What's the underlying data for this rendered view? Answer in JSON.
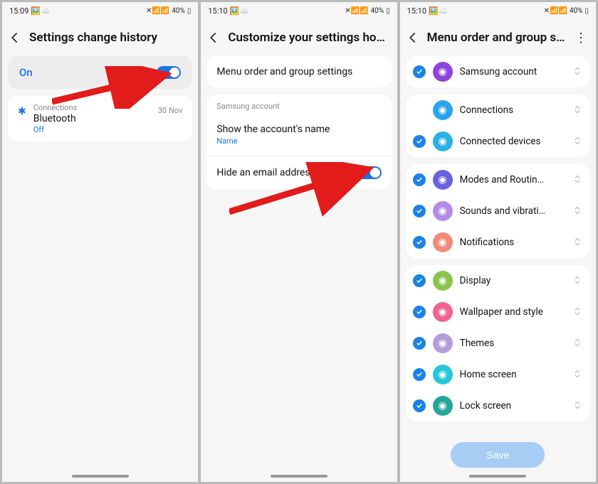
{
  "panel1": {
    "status": {
      "time": "15:09",
      "battery": "40%"
    },
    "title": "Settings change history",
    "toggle_label": "On",
    "history": {
      "category": "Connections",
      "item": "Bluetooth",
      "state": "Off",
      "date": "30 Nov"
    }
  },
  "panel2": {
    "status": {
      "time": "15:10",
      "battery": "40%"
    },
    "title": "Customize your settings home",
    "row_menu": "Menu order and group settings",
    "group_label": "Samsung account",
    "row_show": "Show the account's name",
    "row_show_sub": "Name",
    "row_hide": "Hide an email address"
  },
  "panel3": {
    "status": {
      "time": "15:10",
      "battery": "40%"
    },
    "title": "Menu order and group se…",
    "save": "Save",
    "items": [
      {
        "label": "Samsung account",
        "color": "#8e44db",
        "check": true
      },
      {
        "label": "Connections",
        "color": "#28a3ef",
        "check": false
      },
      {
        "label": "Connected devices",
        "color": "#2bb0e6",
        "check": true
      },
      {
        "label": "Modes and Routin…",
        "color": "#6a61e0",
        "check": true
      },
      {
        "label": "Sounds and vibrati…",
        "color": "#b48be8",
        "check": true
      },
      {
        "label": "Notifications",
        "color": "#f08a7a",
        "check": true
      },
      {
        "label": "Display",
        "color": "#8bc34a",
        "check": true
      },
      {
        "label": "Wallpaper and style",
        "color": "#f06292",
        "check": true
      },
      {
        "label": "Themes",
        "color": "#b39ddb",
        "check": true
      },
      {
        "label": "Home screen",
        "color": "#26c6da",
        "check": true
      },
      {
        "label": "Lock screen",
        "color": "#26a69a",
        "check": true
      }
    ]
  }
}
